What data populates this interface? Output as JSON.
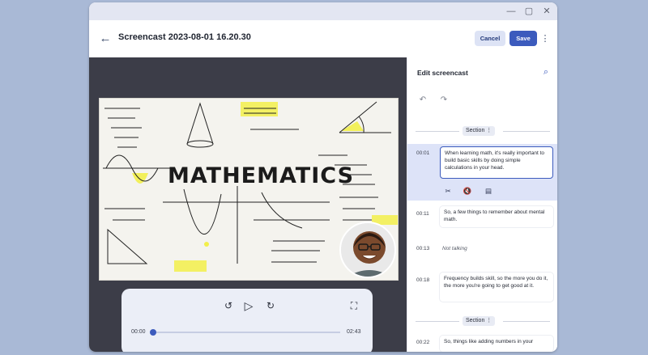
{
  "window": {
    "title": "Screencast 2023-08-01 16.20.30",
    "controls": {
      "minimize": "—",
      "maximize": "▢",
      "close": "✕"
    }
  },
  "toolbar": {
    "back_icon": "arrow-left-icon",
    "cancel_label": "Cancel",
    "save_label": "Save",
    "more_icon": "more-vert-icon"
  },
  "video": {
    "headline": "MATHEMATICS"
  },
  "player": {
    "current_time": "00:00",
    "duration": "02:43",
    "progress": 0.0,
    "icons": [
      "replay-10-icon",
      "play-icon",
      "forward-10-icon",
      "fullscreen-icon"
    ]
  },
  "panel": {
    "title": "Edit screencast",
    "section_label": "Section",
    "entries": [
      {
        "time": "00:01",
        "text": "When learning math, it's really important to build basic skills by doing simple calculations in your head."
      },
      {
        "time": "00:11",
        "text": "So, a few things to remember about mental math."
      },
      {
        "time": "00:13",
        "text": "Not talking"
      },
      {
        "time": "00:18",
        "text": "Frequency builds skill, so the more you do it, the more you're going to get good at it."
      },
      {
        "time": "00:22",
        "text": "So, things like adding numbers in your"
      }
    ],
    "entry_tools": [
      "scissors-icon",
      "mute-icon",
      "document-icon"
    ]
  },
  "colors": {
    "accent": "#3c5bbd",
    "highlight": "#dde3f8",
    "stage": "#3c3d48",
    "desktop": "#a9b9d6"
  }
}
